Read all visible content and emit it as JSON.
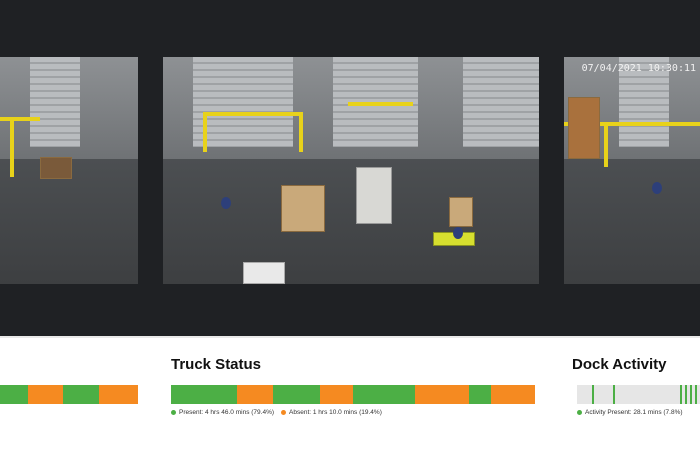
{
  "colors": {
    "present": "#4caf45",
    "absent": "#f58a21",
    "activity_bg": "#e6e6e6",
    "background": "#1f2124"
  },
  "camera_right": {
    "timestamp": "07/04/2021 10:30:11"
  },
  "truck_status": {
    "title": "Truck Status",
    "present_label": "Present: 4 hrs 46.0 mins (79.4%)",
    "absent_label": "Absent: 1 hrs 10.0 mins (19.4%)",
    "segments": [
      {
        "state": "present",
        "fraction": 0.18
      },
      {
        "state": "absent",
        "fraction": 0.1
      },
      {
        "state": "present",
        "fraction": 0.13
      },
      {
        "state": "absent",
        "fraction": 0.09
      },
      {
        "state": "present",
        "fraction": 0.17
      },
      {
        "state": "absent",
        "fraction": 0.15
      },
      {
        "state": "present",
        "fraction": 0.06
      },
      {
        "state": "absent",
        "fraction": 0.12
      }
    ]
  },
  "left_timeline": {
    "segments": [
      {
        "state": "present",
        "fraction": 0.2
      },
      {
        "state": "absent",
        "fraction": 0.26
      },
      {
        "state": "present",
        "fraction": 0.26
      },
      {
        "state": "absent",
        "fraction": 0.28
      }
    ]
  },
  "dock_activity": {
    "title": "Dock Activity",
    "present_label": "Activity Present: 28.1 mins (7.8%)",
    "ticks": [
      0.12,
      0.29,
      0.84,
      0.88,
      0.92,
      0.96
    ]
  }
}
